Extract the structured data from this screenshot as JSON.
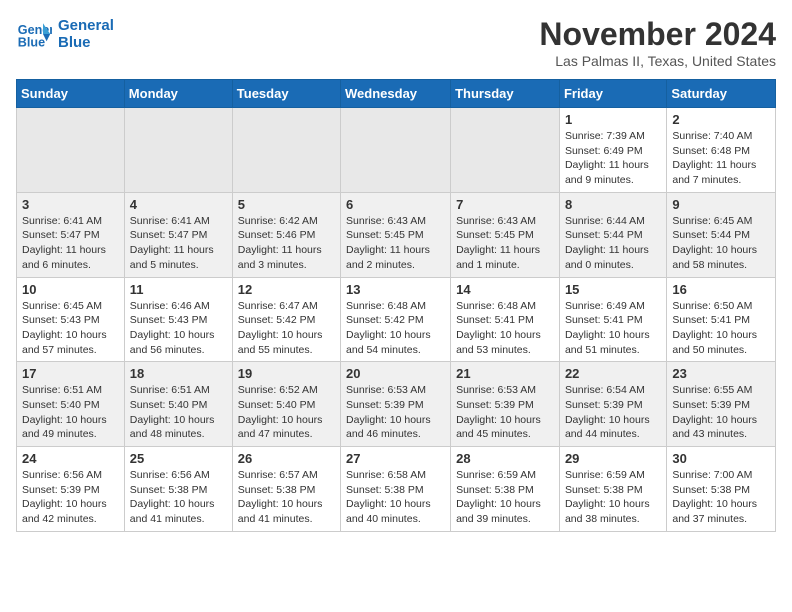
{
  "header": {
    "logo_line1": "General",
    "logo_line2": "Blue",
    "month": "November 2024",
    "location": "Las Palmas II, Texas, United States"
  },
  "days_of_week": [
    "Sunday",
    "Monday",
    "Tuesday",
    "Wednesday",
    "Thursday",
    "Friday",
    "Saturday"
  ],
  "weeks": [
    {
      "row_style": "row-white",
      "days": [
        {
          "num": "",
          "info": "",
          "empty": true
        },
        {
          "num": "",
          "info": "",
          "empty": true
        },
        {
          "num": "",
          "info": "",
          "empty": true
        },
        {
          "num": "",
          "info": "",
          "empty": true
        },
        {
          "num": "",
          "info": "",
          "empty": true
        },
        {
          "num": "1",
          "info": "Sunrise: 7:39 AM\nSunset: 6:49 PM\nDaylight: 11 hours\nand 9 minutes.",
          "empty": false
        },
        {
          "num": "2",
          "info": "Sunrise: 7:40 AM\nSunset: 6:48 PM\nDaylight: 11 hours\nand 7 minutes.",
          "empty": false
        }
      ]
    },
    {
      "row_style": "row-gray",
      "days": [
        {
          "num": "3",
          "info": "Sunrise: 6:41 AM\nSunset: 5:47 PM\nDaylight: 11 hours\nand 6 minutes.",
          "empty": false
        },
        {
          "num": "4",
          "info": "Sunrise: 6:41 AM\nSunset: 5:47 PM\nDaylight: 11 hours\nand 5 minutes.",
          "empty": false
        },
        {
          "num": "5",
          "info": "Sunrise: 6:42 AM\nSunset: 5:46 PM\nDaylight: 11 hours\nand 3 minutes.",
          "empty": false
        },
        {
          "num": "6",
          "info": "Sunrise: 6:43 AM\nSunset: 5:45 PM\nDaylight: 11 hours\nand 2 minutes.",
          "empty": false
        },
        {
          "num": "7",
          "info": "Sunrise: 6:43 AM\nSunset: 5:45 PM\nDaylight: 11 hours\nand 1 minute.",
          "empty": false
        },
        {
          "num": "8",
          "info": "Sunrise: 6:44 AM\nSunset: 5:44 PM\nDaylight: 11 hours\nand 0 minutes.",
          "empty": false
        },
        {
          "num": "9",
          "info": "Sunrise: 6:45 AM\nSunset: 5:44 PM\nDaylight: 10 hours\nand 58 minutes.",
          "empty": false
        }
      ]
    },
    {
      "row_style": "row-white",
      "days": [
        {
          "num": "10",
          "info": "Sunrise: 6:45 AM\nSunset: 5:43 PM\nDaylight: 10 hours\nand 57 minutes.",
          "empty": false
        },
        {
          "num": "11",
          "info": "Sunrise: 6:46 AM\nSunset: 5:43 PM\nDaylight: 10 hours\nand 56 minutes.",
          "empty": false
        },
        {
          "num": "12",
          "info": "Sunrise: 6:47 AM\nSunset: 5:42 PM\nDaylight: 10 hours\nand 55 minutes.",
          "empty": false
        },
        {
          "num": "13",
          "info": "Sunrise: 6:48 AM\nSunset: 5:42 PM\nDaylight: 10 hours\nand 54 minutes.",
          "empty": false
        },
        {
          "num": "14",
          "info": "Sunrise: 6:48 AM\nSunset: 5:41 PM\nDaylight: 10 hours\nand 53 minutes.",
          "empty": false
        },
        {
          "num": "15",
          "info": "Sunrise: 6:49 AM\nSunset: 5:41 PM\nDaylight: 10 hours\nand 51 minutes.",
          "empty": false
        },
        {
          "num": "16",
          "info": "Sunrise: 6:50 AM\nSunset: 5:41 PM\nDaylight: 10 hours\nand 50 minutes.",
          "empty": false
        }
      ]
    },
    {
      "row_style": "row-gray",
      "days": [
        {
          "num": "17",
          "info": "Sunrise: 6:51 AM\nSunset: 5:40 PM\nDaylight: 10 hours\nand 49 minutes.",
          "empty": false
        },
        {
          "num": "18",
          "info": "Sunrise: 6:51 AM\nSunset: 5:40 PM\nDaylight: 10 hours\nand 48 minutes.",
          "empty": false
        },
        {
          "num": "19",
          "info": "Sunrise: 6:52 AM\nSunset: 5:40 PM\nDaylight: 10 hours\nand 47 minutes.",
          "empty": false
        },
        {
          "num": "20",
          "info": "Sunrise: 6:53 AM\nSunset: 5:39 PM\nDaylight: 10 hours\nand 46 minutes.",
          "empty": false
        },
        {
          "num": "21",
          "info": "Sunrise: 6:53 AM\nSunset: 5:39 PM\nDaylight: 10 hours\nand 45 minutes.",
          "empty": false
        },
        {
          "num": "22",
          "info": "Sunrise: 6:54 AM\nSunset: 5:39 PM\nDaylight: 10 hours\nand 44 minutes.",
          "empty": false
        },
        {
          "num": "23",
          "info": "Sunrise: 6:55 AM\nSunset: 5:39 PM\nDaylight: 10 hours\nand 43 minutes.",
          "empty": false
        }
      ]
    },
    {
      "row_style": "row-white",
      "days": [
        {
          "num": "24",
          "info": "Sunrise: 6:56 AM\nSunset: 5:39 PM\nDaylight: 10 hours\nand 42 minutes.",
          "empty": false
        },
        {
          "num": "25",
          "info": "Sunrise: 6:56 AM\nSunset: 5:38 PM\nDaylight: 10 hours\nand 41 minutes.",
          "empty": false
        },
        {
          "num": "26",
          "info": "Sunrise: 6:57 AM\nSunset: 5:38 PM\nDaylight: 10 hours\nand 41 minutes.",
          "empty": false
        },
        {
          "num": "27",
          "info": "Sunrise: 6:58 AM\nSunset: 5:38 PM\nDaylight: 10 hours\nand 40 minutes.",
          "empty": false
        },
        {
          "num": "28",
          "info": "Sunrise: 6:59 AM\nSunset: 5:38 PM\nDaylight: 10 hours\nand 39 minutes.",
          "empty": false
        },
        {
          "num": "29",
          "info": "Sunrise: 6:59 AM\nSunset: 5:38 PM\nDaylight: 10 hours\nand 38 minutes.",
          "empty": false
        },
        {
          "num": "30",
          "info": "Sunrise: 7:00 AM\nSunset: 5:38 PM\nDaylight: 10 hours\nand 37 minutes.",
          "empty": false
        }
      ]
    }
  ]
}
